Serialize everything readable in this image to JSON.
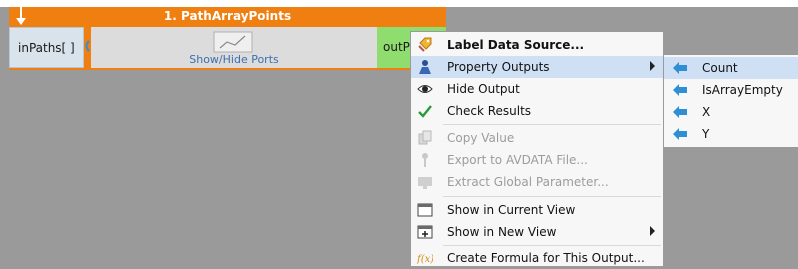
{
  "node": {
    "title": "1. PathArrayPoints",
    "input_port": "inPaths[ ]",
    "center_label": "Show/Hide Ports",
    "output_port": "outPo"
  },
  "menu": {
    "items": [
      {
        "label": "Label Data Source...",
        "icon": "tag-icon",
        "bold": true,
        "enabled": true
      },
      {
        "label": "Property Outputs",
        "icon": "person-icon",
        "enabled": true,
        "submenu": true,
        "highlighted": true
      },
      {
        "label": "Hide Output",
        "icon": "eye-icon",
        "enabled": true
      },
      {
        "label": "Check Results",
        "icon": "checkmark-icon",
        "enabled": true
      },
      {
        "label": "Copy Value",
        "icon": "copy-icon",
        "enabled": false
      },
      {
        "label": "Export to AVDATA File...",
        "icon": "export-icon",
        "enabled": false
      },
      {
        "label": "Extract Global Parameter...",
        "icon": "extract-icon",
        "enabled": false
      },
      {
        "label": "Show in Current View",
        "icon": "window-icon",
        "enabled": true
      },
      {
        "label": "Show in New View",
        "icon": "new-window-icon",
        "enabled": true,
        "submenu": true
      },
      {
        "label": "Create Formula for This Output...",
        "icon": "formula-icon",
        "enabled": true
      }
    ]
  },
  "submenu": {
    "items": [
      {
        "label": "Count",
        "icon": "arrow-left-icon"
      },
      {
        "label": "IsArrayEmpty",
        "icon": "arrow-left-icon"
      },
      {
        "label": "X",
        "icon": "arrow-left-icon"
      },
      {
        "label": "Y",
        "icon": "arrow-left-icon"
      }
    ]
  },
  "colors": {
    "node_header": "#f07f12",
    "input_port": "#d9e3ec",
    "output_port": "#8fdc6f",
    "highlight": "#cfe0f5",
    "icon_blue": "#2f8fd6"
  }
}
